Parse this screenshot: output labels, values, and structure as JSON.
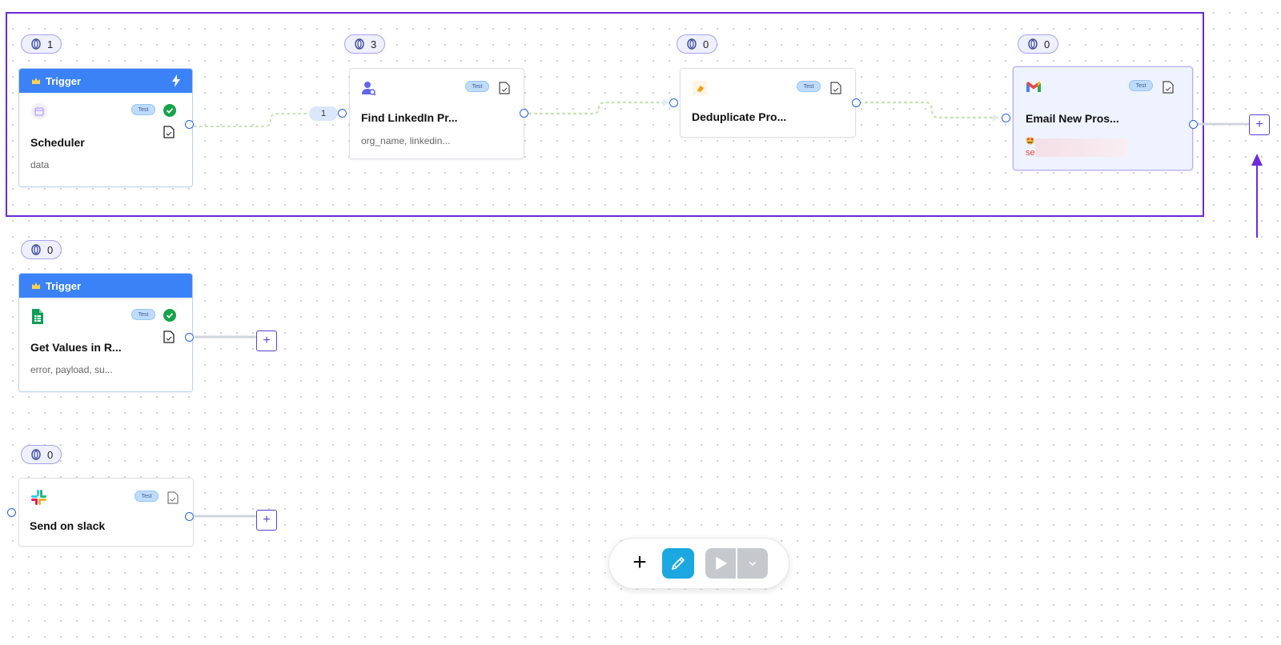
{
  "colors": {
    "accent": "#6d28d9",
    "trigger_header": "#3b82f6",
    "port": "#2563eb",
    "edit_button": "#1ba8e0",
    "success": "#16a34a",
    "error_text": "#e44444"
  },
  "flows": [
    {
      "nodes": [
        {
          "count": "1",
          "is_trigger": true,
          "header": "Trigger",
          "icon": "scheduler-icon",
          "test": "Test",
          "status": "success",
          "title": "Scheduler",
          "subtitle": "data"
        },
        {
          "count": "3",
          "icon": "person-search-icon",
          "test": "Test",
          "title": "Find LinkedIn Pr...",
          "subtitle": "org_name, linkedin...",
          "input_count": "1"
        },
        {
          "count": "0",
          "icon": "eraser-icon",
          "test": "Test",
          "title": "Deduplicate Pro..."
        },
        {
          "count": "0",
          "icon": "gmail-icon",
          "test": "Test",
          "title": "Email New Pros...",
          "selected": true,
          "error_prefix": "set",
          "error_emoji": "🤩"
        }
      ]
    },
    {
      "nodes": [
        {
          "count": "0",
          "is_trigger": true,
          "header": "Trigger",
          "icon": "google-sheets-icon",
          "test": "Test",
          "status": "success",
          "title": "Get Values in R...",
          "subtitle": "error, payload, su..."
        }
      ]
    },
    {
      "nodes": [
        {
          "count": "0",
          "icon": "slack-icon",
          "test": "Test",
          "title": "Send on slack"
        }
      ]
    }
  ],
  "add_button_label": "+",
  "toolbar": {
    "add_label": "+",
    "edit_icon": "pencil-icon",
    "run_icon": "play-icon",
    "run_menu_icon": "chevron-down-icon"
  },
  "annotation": {
    "arrow_icon": "arrow-up-icon"
  }
}
